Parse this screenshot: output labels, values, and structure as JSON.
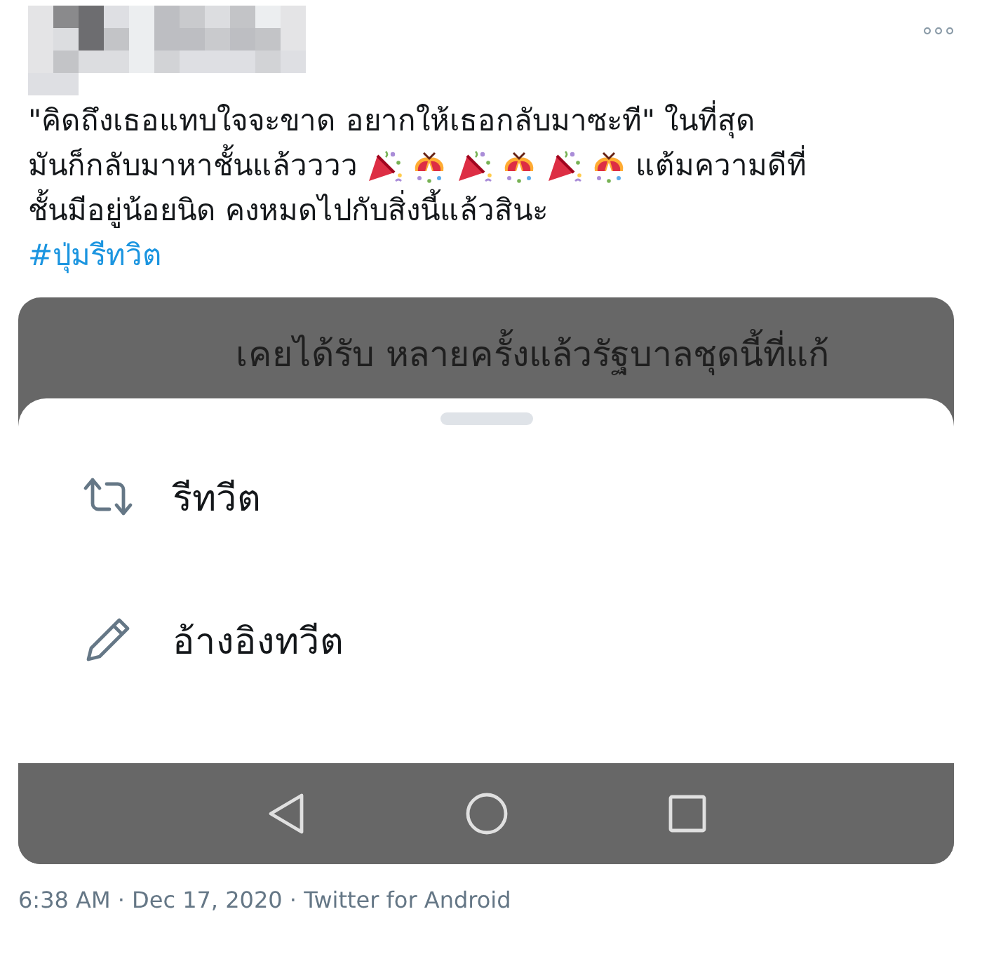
{
  "header": {
    "more_menu": "∘∘∘"
  },
  "tweet": {
    "lines": [
      [
        {
          "kind": "text",
          "text": "\"คิดถึงเธอแทบใจจะขาด อยากให้เธอกลับมาซะที\" ในที่สุด"
        }
      ],
      [
        {
          "kind": "text",
          "text": "มันก็กลับมาหาชั้นแล้วววว"
        },
        {
          "kind": "popper"
        },
        {
          "kind": "confetti"
        },
        {
          "kind": "popper"
        },
        {
          "kind": "confetti"
        },
        {
          "kind": "popper"
        },
        {
          "kind": "confetti"
        },
        {
          "kind": "text",
          "text": "แต้มความดีที่"
        }
      ],
      [
        {
          "kind": "text",
          "text": "ชั้นมีอยู่น้อยนิด คงหมดไปกับสิ่งนี้แล้วสินะ"
        }
      ]
    ],
    "hashtag": "#ปุ่มรีทวิต"
  },
  "media": {
    "background_text": "เคยได้รับ  หลายครั้งแล้วรัฐบาลชุดนี้ที่แก้",
    "sheet_options": [
      {
        "kind": "retweet",
        "label": "รีทวีต"
      },
      {
        "kind": "quote",
        "label": "อ้างอิงทวีต"
      }
    ],
    "nav_buttons": [
      {
        "kind": "back"
      },
      {
        "kind": "home"
      },
      {
        "kind": "recents"
      }
    ]
  },
  "meta": "6:38 AM · Dec 17, 2020 · Twitter for Android"
}
